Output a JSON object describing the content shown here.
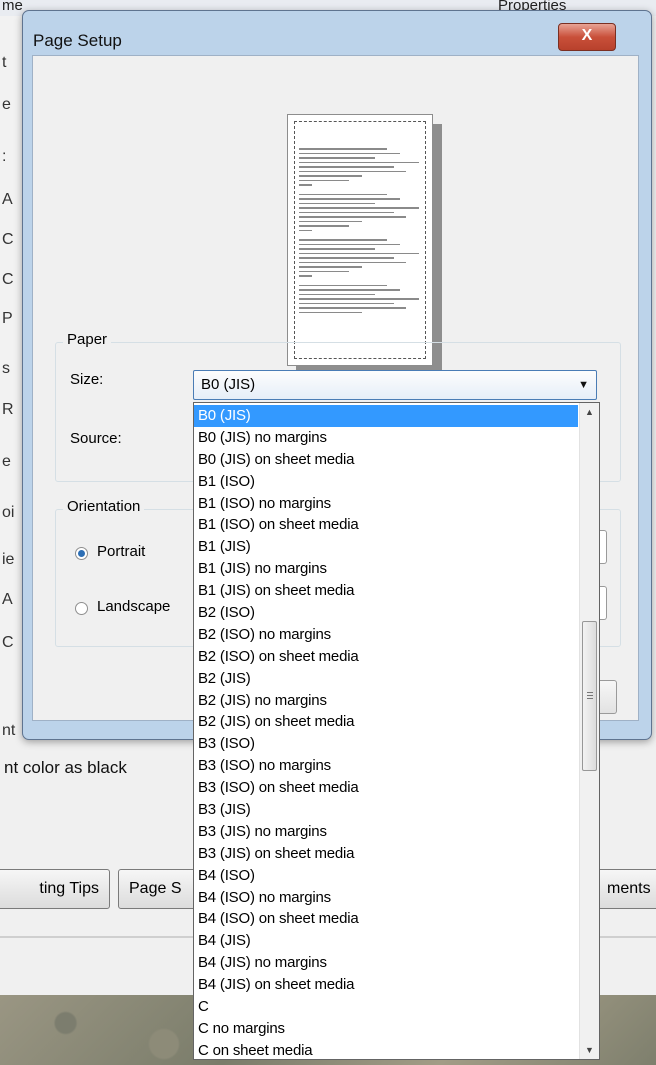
{
  "background": {
    "top_fragments": [
      "me",
      "Properties"
    ],
    "left_letters": [
      "t",
      "e",
      ":",
      "A",
      "C",
      "C",
      "P",
      "s",
      "R",
      "e",
      "oi",
      "ie",
      "A",
      "C",
      "nt"
    ],
    "text_fragment": "nt color as black",
    "buttons": [
      "ting Tips",
      "Page S",
      "ments"
    ]
  },
  "dialog": {
    "title": "Page Setup",
    "close_label": "X",
    "paper": {
      "group_label": "Paper",
      "size_label": "Size:",
      "size_value": "B0 (JIS)",
      "source_label": "Source:"
    },
    "orientation": {
      "group_label": "Orientation",
      "portrait_label": "Portrait",
      "landscape_label": "Landscape",
      "selected": "Portrait"
    }
  },
  "dropdown": {
    "selected": "B0 (JIS)",
    "items": [
      "B0 (JIS)",
      "B0 (JIS) no margins",
      "B0 (JIS) on sheet media",
      "B1 (ISO)",
      "B1 (ISO) no margins",
      "B1 (ISO) on sheet media",
      "B1 (JIS)",
      "B1 (JIS) no margins",
      "B1 (JIS) on sheet media",
      "B2 (ISO)",
      "B2 (ISO) no margins",
      "B2 (ISO) on sheet media",
      "B2 (JIS)",
      "B2 (JIS) no margins",
      "B2 (JIS) on sheet media",
      "B3 (ISO)",
      "B3 (ISO) no margins",
      "B3 (ISO) on sheet media",
      "B3 (JIS)",
      "B3 (JIS) no margins",
      "B3 (JIS) on sheet media",
      "B4 (ISO)",
      "B4 (ISO) no margins",
      "B4 (ISO) on sheet media",
      "B4 (JIS)",
      "B4 (JIS) no margins",
      "B4 (JIS) on sheet media",
      "C",
      "C no margins",
      "C on sheet media"
    ]
  },
  "colors": {
    "selection": "#3399ff",
    "window_frame": "#bcd3ea",
    "close_button": "#c9503a"
  }
}
